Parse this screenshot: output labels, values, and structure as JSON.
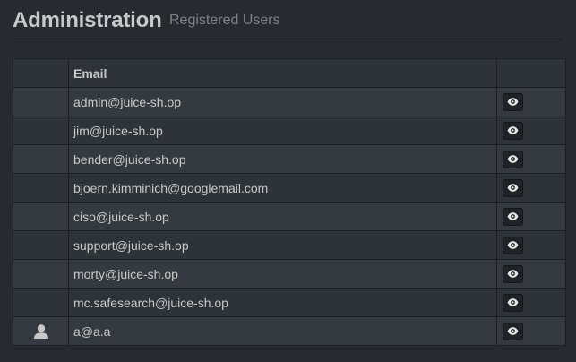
{
  "header": {
    "title": "Administration",
    "subtitle": "Registered Users"
  },
  "table": {
    "columns": [
      "",
      "Email",
      ""
    ],
    "rows": [
      {
        "email": "admin@juice-sh.op",
        "has_avatar": false
      },
      {
        "email": "jim@juice-sh.op",
        "has_avatar": false
      },
      {
        "email": "bender@juice-sh.op",
        "has_avatar": false
      },
      {
        "email": "bjoern.kimminich@googlemail.com",
        "has_avatar": false
      },
      {
        "email": "ciso@juice-sh.op",
        "has_avatar": false
      },
      {
        "email": "support@juice-sh.op",
        "has_avatar": false
      },
      {
        "email": "morty@juice-sh.op",
        "has_avatar": false
      },
      {
        "email": "mc.safesearch@juice-sh.op",
        "has_avatar": false
      },
      {
        "email": "a@a.a",
        "has_avatar": true
      }
    ],
    "row_action_icon": "eye-icon",
    "avatar_icon": "user-icon"
  },
  "colors": {
    "background": "#272b30",
    "row_odd": "#353a40",
    "row_even": "#2e3338",
    "text": "#c8c8c8",
    "muted": "#7a8288",
    "border": "#1c1e22"
  }
}
